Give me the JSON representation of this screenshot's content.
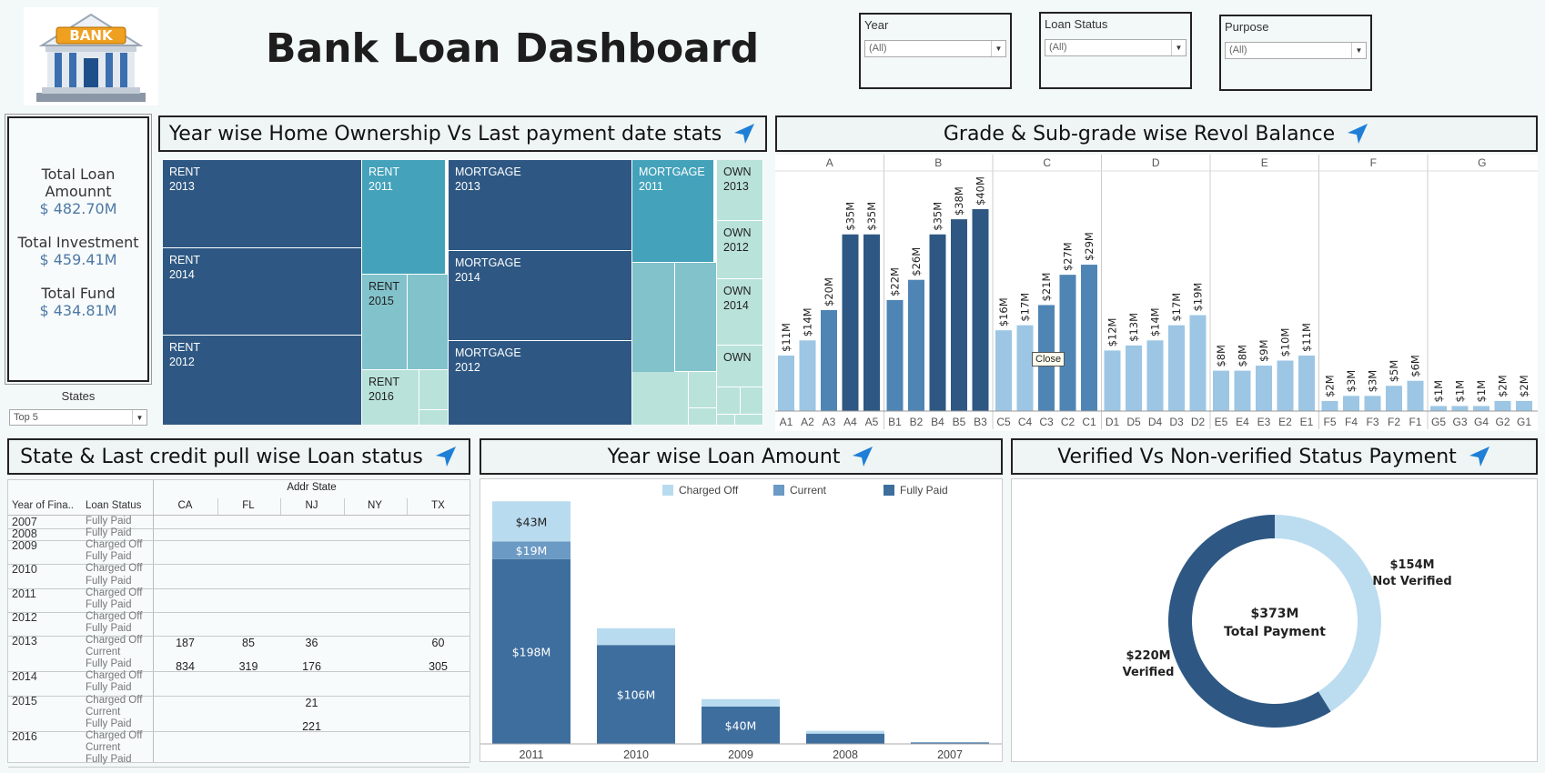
{
  "header": {
    "logo_text": "BANK",
    "title": "Bank Loan Dashboard"
  },
  "filters": [
    {
      "label": "Year",
      "value": "(All)"
    },
    {
      "label": "Loan Status",
      "value": "(All)"
    },
    {
      "label": "Purpose",
      "value": "(All)"
    }
  ],
  "kpis": [
    {
      "label": "Total Loan Amounnt",
      "value": "$ 482.70M"
    },
    {
      "label": "Total Investment",
      "value": "$ 459.41M"
    },
    {
      "label": "Total Fund",
      "value": "$ 434.81M"
    }
  ],
  "states_filter": {
    "label": "States",
    "value": "Top 5"
  },
  "panels": {
    "treemap_title": "Year wise Home Ownership Vs Last payment date stats",
    "grade_title": "Grade & Sub-grade wise Revol Balance",
    "state_title": "State & Last credit pull wise Loan status",
    "year_title": "Year wise Loan Amount",
    "verified_title": "Verified Vs Non-verified Status Payment"
  },
  "colors": {
    "dark": "#2e5883",
    "mid": "#4f85b5",
    "light": "#9cc6e4",
    "lighter": "#c3ddf0",
    "teal": "#44a2bb",
    "teal_light": "#82c2cb",
    "mint": "#b9e2da",
    "accent_arrow": "#1f7fd6"
  },
  "tooltip": {
    "text": "Close"
  },
  "chart_data": [
    {
      "type": "treemap",
      "cells": [
        {
          "l1": "RENT",
          "l2": "2013"
        },
        {
          "l1": "RENT",
          "l2": "2014"
        },
        {
          "l1": "RENT",
          "l2": "2012"
        },
        {
          "l1": "RENT",
          "l2": "2011"
        },
        {
          "l1": "RENT",
          "l2": "2015"
        },
        {
          "l1": "RENT",
          "l2": "2016"
        },
        {
          "l1": "MORTGAGE",
          "l2": "2013"
        },
        {
          "l1": "MORTGAGE",
          "l2": "2014"
        },
        {
          "l1": "MORTGAGE",
          "l2": "2012"
        },
        {
          "l1": "MORTGAGE",
          "l2": "2011"
        },
        {
          "l1": "OWN",
          "l2": "2013"
        },
        {
          "l1": "OWN",
          "l2": "2012"
        },
        {
          "l1": "OWN",
          "l2": "2014"
        },
        {
          "l1": "OWN",
          "l2": ""
        }
      ]
    },
    {
      "type": "bar",
      "unit": "$M",
      "groups": [
        {
          "grade": "A",
          "bars": [
            {
              "sub": "A1",
              "value": 11,
              "label": "$11M"
            },
            {
              "sub": "A2",
              "value": 14,
              "label": "$14M"
            },
            {
              "sub": "A3",
              "value": 20,
              "label": "$20M"
            },
            {
              "sub": "A4",
              "value": 35,
              "label": "$35M"
            },
            {
              "sub": "A5",
              "value": 35,
              "label": "$35M"
            }
          ]
        },
        {
          "grade": "B",
          "bars": [
            {
              "sub": "B1",
              "value": 22,
              "label": "$22M"
            },
            {
              "sub": "B2",
              "value": 26,
              "label": "$26M"
            },
            {
              "sub": "B4",
              "value": 35,
              "label": "$35M"
            },
            {
              "sub": "B5",
              "value": 38,
              "label": "$38M"
            },
            {
              "sub": "B3",
              "value": 40,
              "label": "$40M"
            }
          ]
        },
        {
          "grade": "C",
          "bars": [
            {
              "sub": "C5",
              "value": 16,
              "label": "$16M"
            },
            {
              "sub": "C4",
              "value": 17,
              "label": "$17M"
            },
            {
              "sub": "C3",
              "value": 21,
              "label": "$21M"
            },
            {
              "sub": "C2",
              "value": 27,
              "label": "$27M"
            },
            {
              "sub": "C1",
              "value": 29,
              "label": "$29M"
            }
          ]
        },
        {
          "grade": "D",
          "bars": [
            {
              "sub": "D1",
              "value": 12,
              "label": "$12M"
            },
            {
              "sub": "D5",
              "value": 13,
              "label": "$13M"
            },
            {
              "sub": "D4",
              "value": 14,
              "label": "$14M"
            },
            {
              "sub": "D3",
              "value": 17,
              "label": "$17M"
            },
            {
              "sub": "D2",
              "value": 19,
              "label": "$19M"
            }
          ]
        },
        {
          "grade": "E",
          "bars": [
            {
              "sub": "E5",
              "value": 8,
              "label": "$8M"
            },
            {
              "sub": "E4",
              "value": 8,
              "label": "$8M"
            },
            {
              "sub": "E3",
              "value": 9,
              "label": "$9M"
            },
            {
              "sub": "E2",
              "value": 10,
              "label": "$10M"
            },
            {
              "sub": "E1",
              "value": 11,
              "label": "$11M"
            }
          ]
        },
        {
          "grade": "F",
          "bars": [
            {
              "sub": "F5",
              "value": 2,
              "label": "$2M"
            },
            {
              "sub": "F4",
              "value": 3,
              "label": "$3M"
            },
            {
              "sub": "F3",
              "value": 3,
              "label": "$3M"
            },
            {
              "sub": "F2",
              "value": 5,
              "label": "$5M"
            },
            {
              "sub": "F1",
              "value": 6,
              "label": "$6M"
            }
          ]
        },
        {
          "grade": "G",
          "bars": [
            {
              "sub": "G5",
              "value": 1,
              "label": "$1M"
            },
            {
              "sub": "G3",
              "value": 1,
              "label": "$1M"
            },
            {
              "sub": "G4",
              "value": 1,
              "label": "$1M"
            },
            {
              "sub": "G2",
              "value": 2,
              "label": "$2M"
            },
            {
              "sub": "G1",
              "value": 2,
              "label": "$2M"
            }
          ]
        }
      ]
    },
    {
      "type": "table",
      "column_header": "Addr State",
      "row_headers": [
        "Year of Fina..",
        "Loan Status"
      ],
      "columns": [
        "CA",
        "FL",
        "NJ",
        "NY",
        "TX"
      ],
      "years": [
        {
          "year": "2007",
          "rows": [
            {
              "status": "Fully Paid",
              "values": [
                "",
                "",
                "",
                "",
                ""
              ]
            }
          ]
        },
        {
          "year": "2008",
          "rows": [
            {
              "status": "Fully Paid",
              "values": [
                "",
                "",
                "",
                "",
                ""
              ]
            }
          ]
        },
        {
          "year": "2009",
          "rows": [
            {
              "status": "Charged Off",
              "values": [
                "",
                "",
                "",
                "",
                ""
              ]
            },
            {
              "status": "Fully Paid",
              "values": [
                "",
                "",
                "",
                "",
                ""
              ]
            }
          ]
        },
        {
          "year": "2010",
          "rows": [
            {
              "status": "Charged Off",
              "values": [
                "",
                "",
                "",
                "",
                ""
              ]
            },
            {
              "status": "Fully Paid",
              "values": [
                "",
                "",
                "",
                "",
                ""
              ]
            }
          ]
        },
        {
          "year": "2011",
          "rows": [
            {
              "status": "Charged Off",
              "values": [
                "",
                "",
                "",
                "",
                ""
              ]
            },
            {
              "status": "Fully Paid",
              "values": [
                "",
                "",
                "",
                "",
                ""
              ]
            }
          ]
        },
        {
          "year": "2012",
          "rows": [
            {
              "status": "Charged Off",
              "values": [
                "",
                "",
                "",
                "",
                ""
              ]
            },
            {
              "status": "Fully Paid",
              "values": [
                "",
                "",
                "",
                "",
                ""
              ]
            }
          ]
        },
        {
          "year": "2013",
          "rows": [
            {
              "status": "Charged Off",
              "values": [
                "187",
                "85",
                "36",
                "",
                "60"
              ]
            },
            {
              "status": "Current",
              "values": [
                "",
                "",
                "",
                "",
                ""
              ]
            },
            {
              "status": "Fully Paid",
              "values": [
                "834",
                "319",
                "176",
                "",
                "305"
              ]
            }
          ]
        },
        {
          "year": "2014",
          "rows": [
            {
              "status": "Charged Off",
              "values": [
                "",
                "",
                "",
                "",
                ""
              ]
            },
            {
              "status": "Fully Paid",
              "values": [
                "",
                "",
                "",
                "",
                ""
              ]
            }
          ]
        },
        {
          "year": "2015",
          "rows": [
            {
              "status": "Charged Off",
              "values": [
                "",
                "",
                "21",
                "",
                ""
              ]
            },
            {
              "status": "Current",
              "values": [
                "",
                "",
                "",
                "",
                ""
              ]
            },
            {
              "status": "Fully Paid",
              "values": [
                "",
                "",
                "221",
                "",
                ""
              ]
            }
          ]
        },
        {
          "year": "2016",
          "rows": [
            {
              "status": "Charged Off",
              "values": [
                "",
                "",
                "",
                "",
                ""
              ]
            },
            {
              "status": "Current",
              "values": [
                "",
                "",
                "",
                "",
                ""
              ]
            },
            {
              "status": "Fully Paid",
              "values": [
                "",
                "",
                "",
                "",
                ""
              ]
            }
          ]
        }
      ]
    },
    {
      "type": "bar",
      "stacked": true,
      "categories": [
        "2011",
        "2010",
        "2009",
        "2008",
        "2007"
      ],
      "series": [
        {
          "name": "Charged Off",
          "values": [
            43,
            18,
            8,
            3,
            0.6
          ],
          "labels": [
            "$43M",
            "",
            "",
            "",
            ""
          ]
        },
        {
          "name": "Current",
          "values": [
            19,
            0,
            0,
            0,
            0
          ],
          "labels": [
            "$19M",
            "",
            "",
            "",
            ""
          ]
        },
        {
          "name": "Fully Paid",
          "values": [
            198,
            106,
            40,
            11,
            1.5
          ],
          "labels": [
            "$198M",
            "$106M",
            "$40M",
            "",
            ""
          ]
        }
      ],
      "ylim": [
        0,
        270
      ]
    },
    {
      "type": "pie",
      "donut": true,
      "center_value": "$373M",
      "center_label": "Total Payment",
      "slices": [
        {
          "name": "Not Verified",
          "value": 154,
          "label": "$154M"
        },
        {
          "name": "Verified",
          "value": 220,
          "label": "$220M"
        }
      ]
    }
  ]
}
